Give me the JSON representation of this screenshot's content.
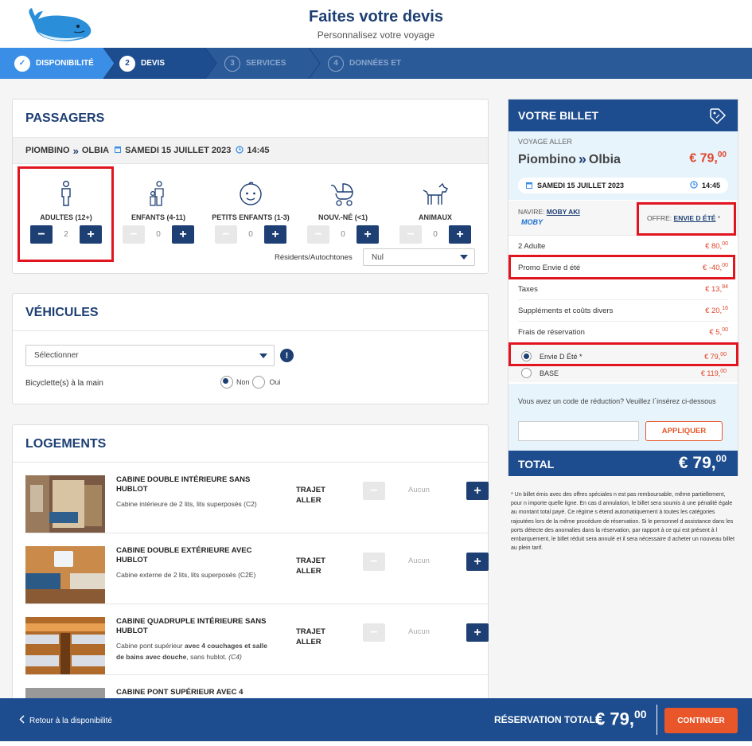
{
  "header": {
    "title": "Faites votre devis",
    "subtitle": "Personnalisez votre voyage"
  },
  "steps": [
    {
      "num": "✓",
      "label": "DISPONIBILITÉ",
      "state": "done"
    },
    {
      "num": "2",
      "label": "DEVIS",
      "state": "active"
    },
    {
      "num": "3",
      "label": "SERVICES",
      "state": "todo"
    },
    {
      "num": "4",
      "label": "DONNÉES ET",
      "state": "todo"
    }
  ],
  "passengers": {
    "title": "PASSAGERS",
    "route": {
      "from": "PIOMBINO",
      "to": "OLBIA",
      "date": "SAMEDI 15 JUILLET 2023",
      "time": "14:45"
    },
    "types": [
      {
        "label": "ADULTES (12+)",
        "value": "2",
        "icon": "adult-icon"
      },
      {
        "label": "ENFANTS (4-11)",
        "value": "0",
        "icon": "child-icon"
      },
      {
        "label": "PETITS ENFANTS (1-3)",
        "value": "0",
        "icon": "baby-face-icon"
      },
      {
        "label": "NOUV.-NÉ (<1)",
        "value": "0",
        "icon": "stroller-icon"
      },
      {
        "label": "ANIMAUX",
        "value": "0",
        "icon": "dog-icon"
      }
    ],
    "residents_label": "Résidents/Autochtones",
    "residents_value": "Nul"
  },
  "vehicles": {
    "title": "VÉHICULES",
    "select_value": "Sélectionner",
    "bicycle_label": "Bicyclette(s) à la main",
    "no_label": "Non",
    "yes_label": "Oui"
  },
  "lodging": {
    "title": "LOGEMENTS",
    "trip_label_1": "TRAJET",
    "trip_label_2": "ALLER",
    "none_label": "Aucun",
    "cabins": [
      {
        "title": "CABINE DOUBLE INTÉRIEURE SANS HUBLOT",
        "desc": "Cabine intérieure de 2 lits, lits superposés (C2)"
      },
      {
        "title": "CABINE DOUBLE EXTÉRIEURE AVEC HUBLOT",
        "desc": "Cabine externe de 2 lits, lits superposés (C2E)"
      },
      {
        "title": "CABINE QUADRUPLE INTÉRIEURE SANS HUBLOT",
        "desc_a": "Cabine pont supérieur ",
        "desc_b": "avec 4 couchages et salle de bains avec douche",
        "desc_c": ", sans hublot. ",
        "desc_d": "(C4)"
      },
      {
        "title": "CABINE PONT SUPÉRIEUR AVEC 4",
        "desc": ""
      }
    ]
  },
  "ticket": {
    "title": "VOTRE BILLET",
    "voyage_label": "VOYAGE ALLER",
    "from": "Piombino",
    "to": "Olbia",
    "price_main": "€ 79,",
    "price_cents": "00",
    "date": "SAMEDI 15 JUILLET 2023",
    "time": "14:45",
    "ship_label": "NAVIRE:",
    "ship_name": "MOBY AKI",
    "brand": "MOBY",
    "offer_label": "OFFRE:",
    "offer_name": "ENVIE D  ÉTÉ",
    "offer_star": "*",
    "lines": [
      {
        "label": "2 Adulte",
        "price": "€ 80,",
        "cents": "00"
      },
      {
        "label": "Promo Envie d été",
        "price": "€ -40,",
        "cents": "00"
      },
      {
        "label": "Taxes",
        "price": "€ 13,",
        "cents": "84"
      },
      {
        "label": "Suppléments et coûts divers",
        "price": "€ 20,",
        "cents": "16"
      },
      {
        "label": "Frais de réservation",
        "price": "€ 5,",
        "cents": "00"
      }
    ],
    "options": [
      {
        "label": "Envie D  Été *",
        "price": "€ 79,",
        "cents": "00"
      },
      {
        "label": "BASE",
        "price": "€ 119,",
        "cents": "00"
      }
    ],
    "promo_text": "Vous avez un code de réduction? Veuillez l´insérez ci-dessous",
    "apply_label": "APPLIQUER",
    "total_label": "TOTAL",
    "total_main": "€ 79,",
    "total_cents": "00"
  },
  "disclaimer": "* Un billet émis avec des offres spéciales n  est pas remboursable, même partiellement, pour n  importe quelle ligne. En cas d  annulation, le billet sera soumis à une pénalité égale au montant total payé. Ce régime s  étend automatiquement à toutes les catégories rajoutées lors de la même procédure de réservation. Si le personnel d  assistance dans les ports détecte des anomalies dans la réservation, par rapport à ce qui est présent à l  embarquement, le billet réduit sera annulé et il sera nécessaire d  acheter un nouveau billet au plein tarif.",
  "footer": {
    "back_label": "Retour à la disponibilité",
    "total_label": "RÉSERVATION TOTALE",
    "total_main": "€ 79,",
    "total_cents": "00",
    "continue_label": "CONTINUER"
  },
  "colors": {
    "brand": "#1d4d8f",
    "dark": "#1d3f73",
    "accent": "#e8562a",
    "highlight": "#e0151f"
  }
}
